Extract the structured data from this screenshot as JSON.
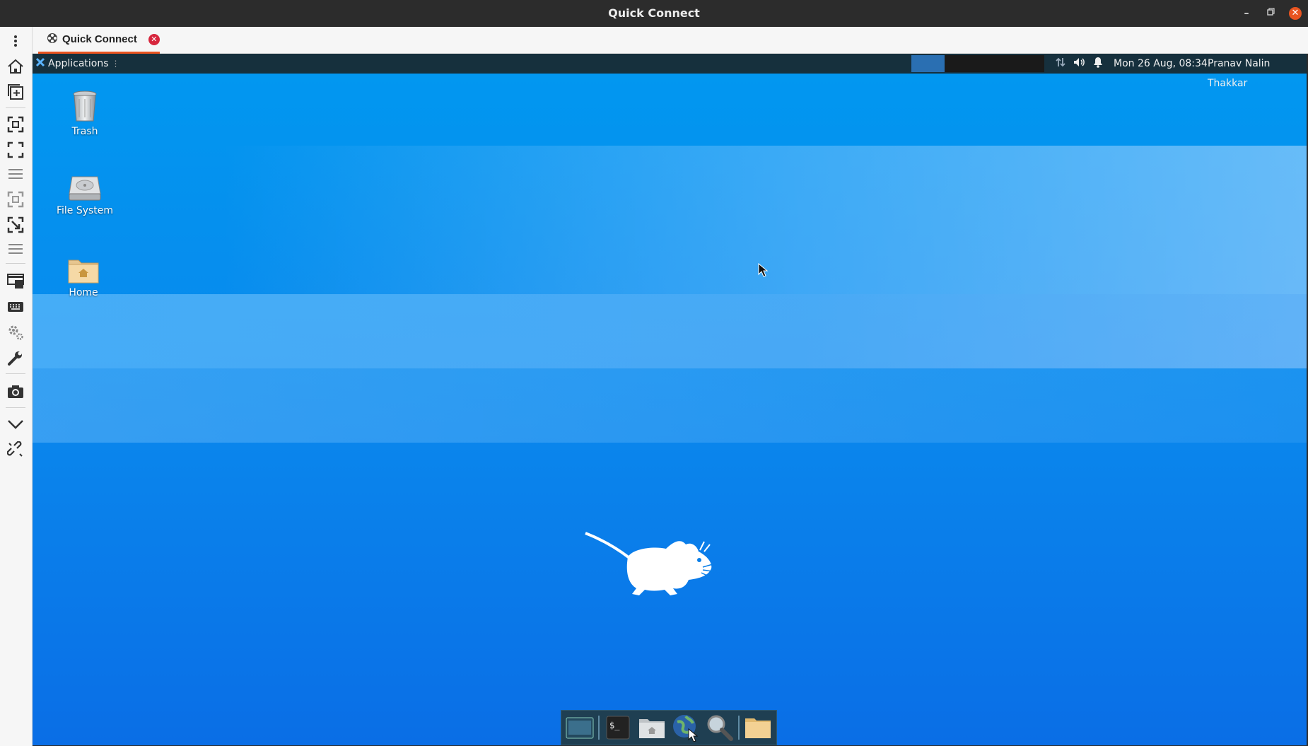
{
  "window": {
    "title": "Quick Connect"
  },
  "tabs": [
    {
      "label": "Quick Connect"
    }
  ],
  "toolbar": {
    "items": [
      "menu-icon",
      "home-icon",
      "new-tab-icon",
      "fit-window-icon",
      "fullscreen-icon",
      "list-icon",
      "scale-icon",
      "multi-monitor-icon",
      "list-icon",
      "dynamic-resolution-icon",
      "keyboard-icon",
      "preferences-icon",
      "tools-icon",
      "screenshot-icon",
      "minimize-toolbar-icon",
      "disconnect-icon"
    ]
  },
  "remote_desktop": {
    "panel": {
      "applications_label": "Applications",
      "clock": "Mon 26 Aug, 08:34",
      "user": "Pranav Nalin Thakkar"
    },
    "icons": [
      {
        "label": "Trash",
        "icon": "trash-icon"
      },
      {
        "label": "File System",
        "icon": "drive-icon"
      },
      {
        "label": "Home",
        "icon": "home-folder-icon"
      }
    ],
    "dock": [
      "show-desktop-icon",
      "terminal-icon",
      "file-manager-icon",
      "web-browser-icon",
      "app-finder-icon",
      "folder-icon"
    ]
  },
  "colors": {
    "accent": "#e95420",
    "panel": "#16303d",
    "desktop": "#0a86ec"
  }
}
